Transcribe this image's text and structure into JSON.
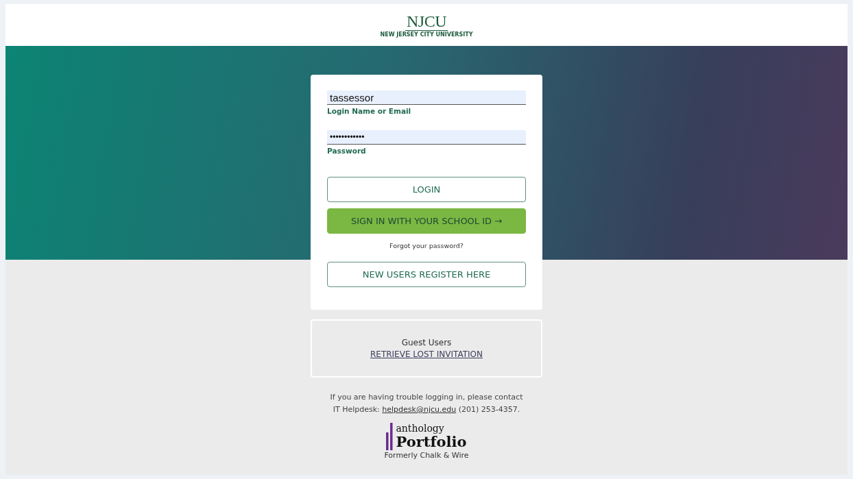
{
  "header": {
    "logo": "NJCU",
    "logo_subtitle": "NEW JERSEY CITY UNIVERSITY"
  },
  "login_form": {
    "fields": [
      {
        "kind": "text",
        "value": "tassessor",
        "label": "Login Name or Email"
      },
      {
        "kind": "password",
        "value": "••••••••••••",
        "label": "Password"
      }
    ],
    "buttons": [
      {
        "kind": "outline",
        "label": "LOGIN"
      },
      {
        "kind": "primary",
        "label": "SIGN IN WITH YOUR SCHOOL ID →"
      },
      {
        "kind": "link",
        "label": "Forgot your password?"
      },
      {
        "kind": "outline",
        "label": "NEW USERS REGISTER HERE"
      }
    ]
  },
  "guest_box": {
    "title": "Guest Users",
    "link": "RETRIEVE LOST INVITATION"
  },
  "help_text": {
    "line_1": "If you are having trouble logging in, please contact",
    "prefix": "IT Helpdesk:",
    "email": "helpdesk@njcu.edu",
    "phone": "(201) 253-4357."
  },
  "brand": {
    "name": "anthology",
    "product": "Portfolio",
    "tagline": "Formerly Chalk & Wire"
  }
}
